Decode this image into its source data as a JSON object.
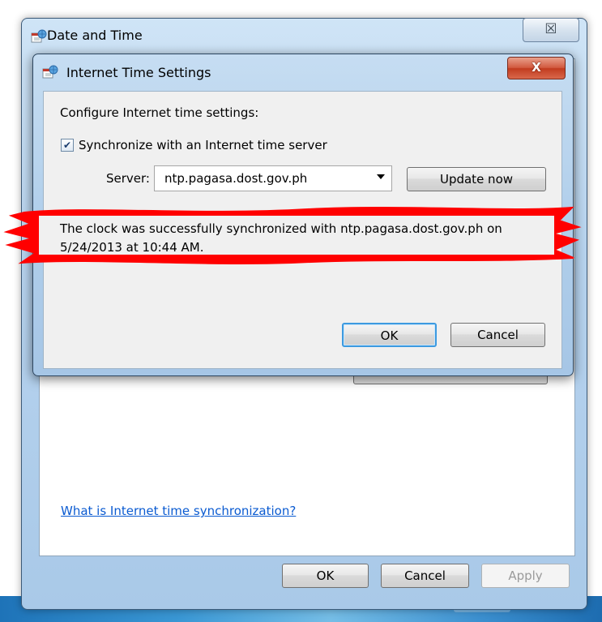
{
  "outer_window": {
    "title": "Date and Time",
    "close_glyph": "☒",
    "help_link": "What is Internet time synchronization?",
    "buttons": {
      "ok": "OK",
      "cancel": "Cancel",
      "apply": "Apply"
    }
  },
  "dialog": {
    "title": "Internet Time Settings",
    "close_glyph": "X",
    "heading": "Configure Internet time settings:",
    "sync_checkbox": {
      "label": "Synchronize with an Internet time server",
      "checked": true,
      "glyph": "✔"
    },
    "server": {
      "label": "Server:",
      "value": "ntp.pagasa.dost.gov.ph"
    },
    "update_button": "Update now",
    "status": {
      "line1": "The clock was successfully synchronized with ntp.pagasa.dost.gov.ph on",
      "line2": "5/24/2013 at 10:44 AM.",
      "highlight_color": "#ff0000"
    },
    "buttons": {
      "ok": "OK",
      "cancel": "Cancel"
    }
  },
  "icons": {
    "window_icon": "date-time-globe-icon",
    "dropdown": "chevron-down-icon"
  },
  "colors": {
    "link": "#0b5bd1",
    "default_button_border": "#3d9ae0",
    "close_button": "#c9472a"
  }
}
